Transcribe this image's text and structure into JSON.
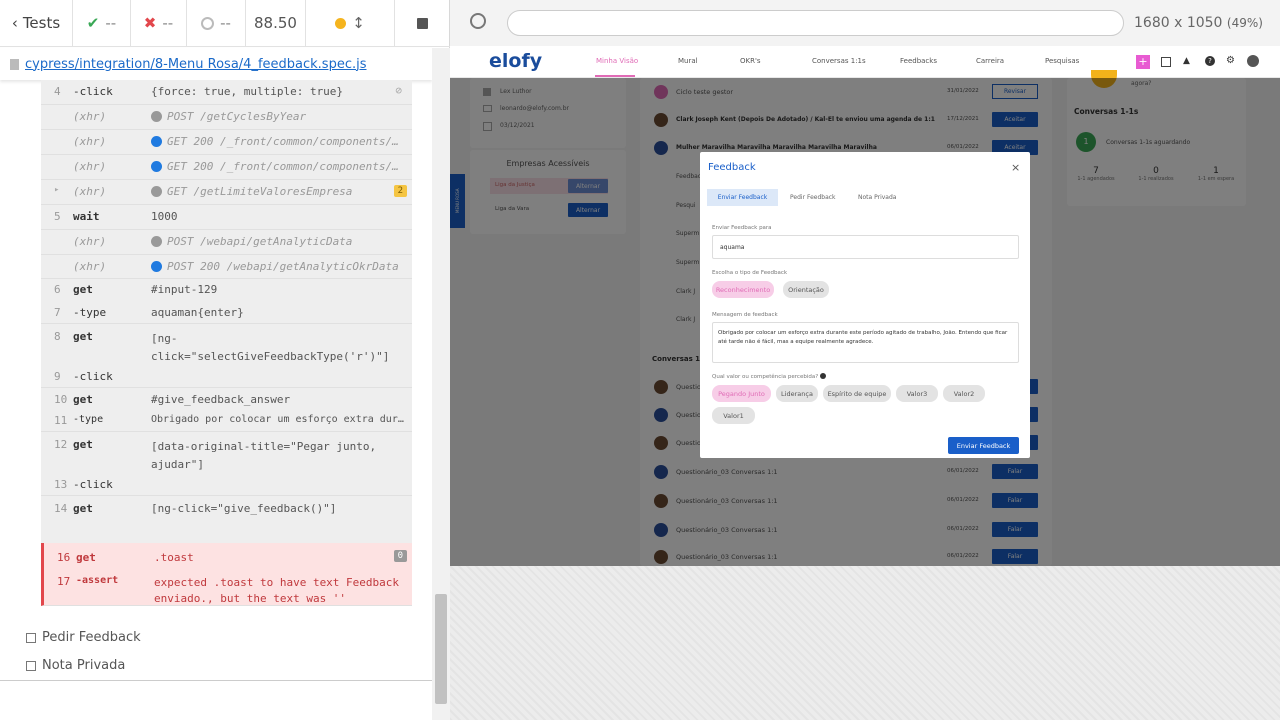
{
  "runner": {
    "tests_label": "Tests",
    "passed": "--",
    "failed": "--",
    "pending": "--",
    "duration": "88.50",
    "viewport": "1680 x 1050",
    "zoom": "(49%)",
    "spec_path": "cypress/integration/8-Menu Rosa/4_feedback.spec.js"
  },
  "log": [
    {
      "n": "4",
      "cmd": "-click",
      "msg": "{force: true, multiple: true}"
    },
    {
      "n": "",
      "cmd": "(xhr)",
      "msg": "POST /getCyclesByYear",
      "dot": "#999"
    },
    {
      "n": "",
      "cmd": "(xhr)",
      "msg": "GET 200 /_front/common/components/…",
      "dot": "#1f7ae0"
    },
    {
      "n": "",
      "cmd": "(xhr)",
      "msg": "GET 200 /_front/common/components/…",
      "dot": "#1f7ae0"
    },
    {
      "n": "",
      "cmd": "(xhr)",
      "msg": "GET /getLimiteValoresEmpresa",
      "dot": "#999",
      "badge": "2"
    },
    {
      "n": "5",
      "cmd": "wait",
      "msg": "1000"
    },
    {
      "n": "",
      "cmd": "(xhr)",
      "msg": "POST /webapi/getAnalyticData",
      "dot": "#999"
    },
    {
      "n": "",
      "cmd": "(xhr)",
      "msg": "POST 200 /webapi/getAnalyticOkrData",
      "dot": "#1f7ae0"
    },
    {
      "n": "6",
      "cmd": "get",
      "msg": "#input-129"
    },
    {
      "n": "7",
      "cmd": "-type",
      "msg": "aquaman{enter}"
    },
    {
      "n": "8",
      "cmd": "get",
      "msg": "[ng-click=\"selectGiveFeedbackType('r')\"]"
    },
    {
      "n": "9",
      "cmd": "-click",
      "msg": ""
    },
    {
      "n": "10",
      "cmd": "get",
      "msg": "#give_feedback_answer"
    },
    {
      "n": "11",
      "cmd": "-type",
      "msg": "Obrigado por colocar um esforço extra durant…"
    },
    {
      "n": "12",
      "cmd": "get",
      "msg": "[data-original-title=\"Pegar junto, ajudar\"]"
    },
    {
      "n": "13",
      "cmd": "-click",
      "msg": ""
    },
    {
      "n": "14",
      "cmd": "get",
      "msg": "[ng-click=\"give_feedback()\"]"
    },
    {
      "n": "15",
      "cmd": "-click",
      "msg": ""
    },
    {
      "n": "16",
      "cmd": "get",
      "msg": ".toast",
      "badge": "0"
    },
    {
      "n": "17",
      "cmd": "-assert",
      "msg": "expected .toast to have text Feedback enviado., but the text was ''"
    }
  ],
  "tests": [
    "Pedir Feedback",
    "Nota Privada"
  ],
  "app": {
    "logo": "elofy",
    "nav": [
      "Minha Visão",
      "Mural",
      "OKR's",
      "Conversas 1:1s",
      "Feedbacks",
      "Carreira",
      "Pesquisas"
    ],
    "profile": {
      "name": "Lex Luthor",
      "email": "leonardo@elofy.com.br",
      "date": "03/12/2021"
    },
    "companies_title": "Empresas Acessíveis",
    "companies": [
      {
        "name": "Liga da Justiça",
        "action": "Alternar"
      },
      {
        "name": "Liga da Vara",
        "action": "Alternar"
      }
    ],
    "side_tab": "MENU ROSA",
    "conv_title": "Conversas 1-1s",
    "conv_waiting": "Conversas 1-1s aguardando",
    "conv_count": "1",
    "stats": [
      {
        "v": "7",
        "l": "1-1 agendados"
      },
      {
        "v": "0",
        "l": "1-1 realizados"
      },
      {
        "v": "1",
        "l": "1-1 em espera"
      }
    ],
    "agora": "agora?",
    "list": [
      {
        "t": "Ciclo teste gestor",
        "d": "31/01/2022",
        "b": "Revisar"
      },
      {
        "t": "Clark Joseph Kent (Depois De Adotado) / Kal-El te enviou uma agenda de 1:1",
        "d": "17/12/2021",
        "b": "Aceitar"
      },
      {
        "t": "Mulher Maravilha Maravilha Maravilha Maravilha Maravilha",
        "d": "06/01/2022",
        "b": "Aceitar"
      }
    ],
    "list_partial": [
      "Feedback",
      "Pesqui",
      "Superm",
      "Superm",
      "Clark J",
      "Clark J"
    ],
    "conv_section": "Conversas 1-",
    "q_rows": [
      {
        "t": "Questionário",
        "d": "",
        "b": "Falar"
      },
      {
        "t": "Questionário",
        "d": "",
        "b": "Falar"
      },
      {
        "t": "Questionário",
        "d": "",
        "b": "Falar"
      },
      {
        "t": "Questionário_03   Conversas 1:1",
        "d": "06/01/2022",
        "b": "Falar"
      },
      {
        "t": "Questionário_03   Conversas 1:1",
        "d": "06/01/2022",
        "b": "Falar"
      },
      {
        "t": "Questionário_03   Conversas 1:1",
        "d": "06/01/2022",
        "b": "Falar"
      },
      {
        "t": "Questionário_03   Conversas 1:1",
        "d": "06/01/2022",
        "b": "Falar"
      }
    ]
  },
  "modal": {
    "title": "Feedback",
    "close": "×",
    "tabs": [
      "Enviar Feedback",
      "Pedir Feedback",
      "Nota Privada"
    ],
    "to_label": "Enviar Feedback para",
    "to_value": "aquama",
    "type_label": "Escolha o tipo de Feedback",
    "types": [
      "Reconhecimento",
      "Orientação"
    ],
    "msg_label": "Mensagem de feedback",
    "msg_value": "Obrigado por colocar um esforço extra durante este período agitado de trabalho, João. Entendo que ficar até tarde não é fácil, mas a equipe realmente agradece.",
    "values_label": "Qual valor ou competência percebida?",
    "values": [
      "Pegando Junto",
      "Liderança",
      "Espírito de equipe",
      "Valor3",
      "Valor2",
      "Valor1"
    ],
    "submit": "Enviar Feedback"
  }
}
